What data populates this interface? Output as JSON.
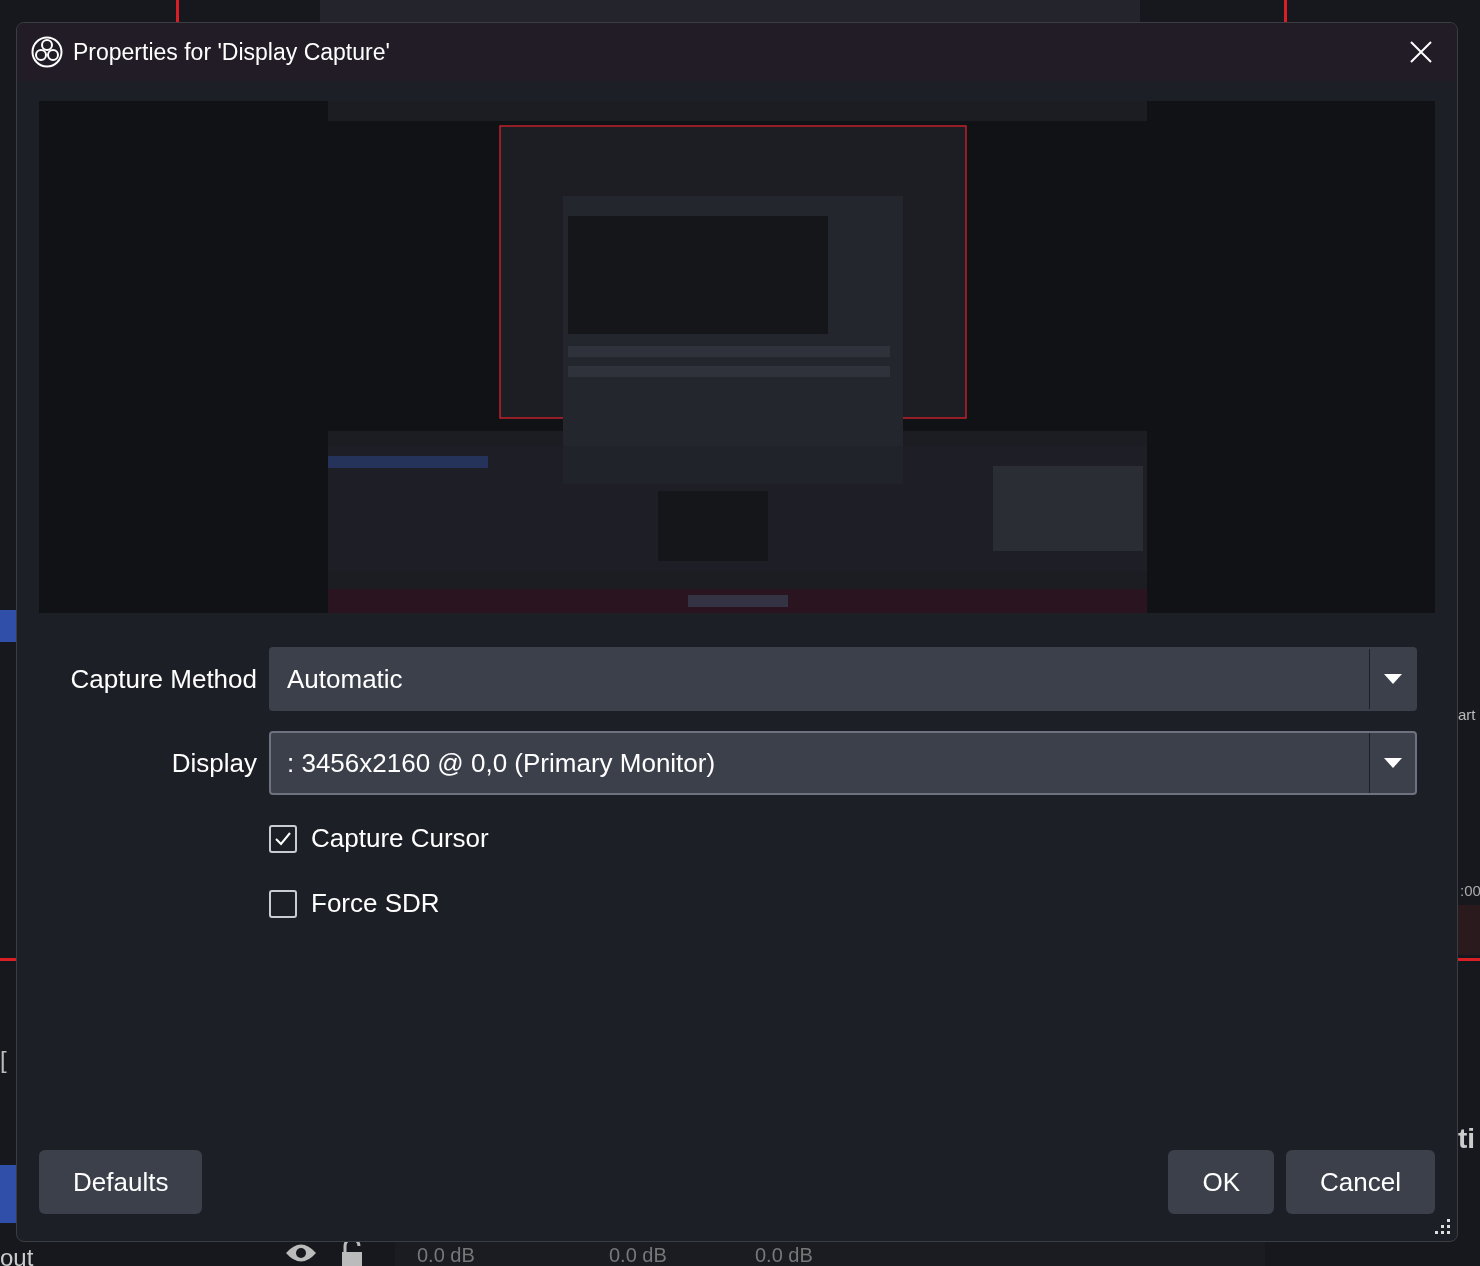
{
  "background": {
    "texts": [
      "[",
      "out",
      "art",
      ":00",
      "ti"
    ],
    "meters": [
      "0.0 dB",
      "0.0 dB",
      "0.0 dB"
    ]
  },
  "window": {
    "title": "Properties for 'Display Capture'"
  },
  "fields": [
    {
      "label": "Capture Method",
      "value": "Automatic",
      "focused": false
    },
    {
      "label": "Display",
      "value": ": 3456x2160 @ 0,0 (Primary Monitor)",
      "focused": true
    }
  ],
  "checkboxes": [
    {
      "label": "Capture Cursor",
      "checked": true
    },
    {
      "label": "Force SDR",
      "checked": false
    }
  ],
  "buttons": {
    "left": [
      "Defaults"
    ],
    "right": [
      "OK",
      "Cancel"
    ]
  }
}
